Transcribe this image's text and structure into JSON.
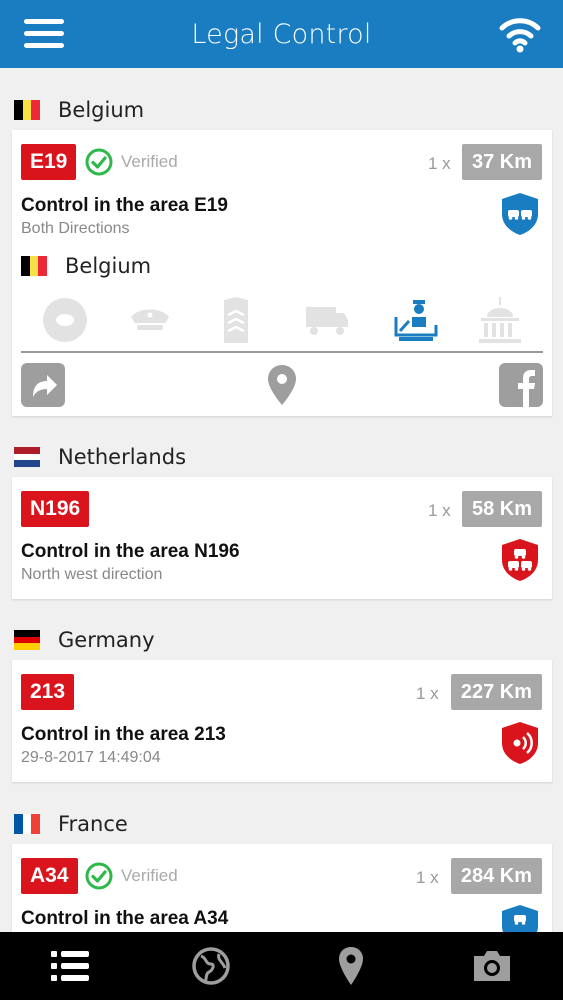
{
  "header": {
    "title": "Legal Control",
    "menu_icon": "hamburger-icon",
    "status_icon": "wifi-icon"
  },
  "colors": {
    "primary": "#1a7cc1",
    "road_red": "#d9141c",
    "verified_green": "#2eb84a",
    "km_grey": "#a8a8a8",
    "icon_blue": "#1a7cc1"
  },
  "controls": [
    {
      "country": "Belgium",
      "road": "E19",
      "verified": true,
      "verified_label": "Verified",
      "count": "1 x",
      "distance": "37 Km",
      "title": "Control in the area E19",
      "subtitle": "Both Directions",
      "shield_color": "blue",
      "shield_icon": "cars-icon",
      "expanded": true,
      "detail_country": "Belgium",
      "categories": [
        "speed-camera-icon",
        "police-cap-icon",
        "military-icon",
        "truck-icon",
        "customs-icon",
        "government-icon"
      ],
      "active_category": "customs-icon",
      "actions": [
        "share-icon",
        "location-pin-icon",
        "facebook-icon"
      ]
    },
    {
      "country": "Netherlands",
      "road": "N196",
      "verified": false,
      "count": "1 x",
      "distance": "58 Km",
      "title": "Control in the area N196",
      "subtitle": "North west direction",
      "shield_color": "red",
      "shield_icon": "cars-icon"
    },
    {
      "country": "Germany",
      "road": "213",
      "verified": false,
      "count": "1 x",
      "distance": "227 Km",
      "title": "Control in the area 213",
      "subtitle": "29-8-2017 14:49:04",
      "shield_color": "red",
      "shield_icon": "radar-icon"
    },
    {
      "country": "France",
      "road": "A34",
      "verified": true,
      "verified_label": "Verified",
      "count": "1 x",
      "distance": "284 Km",
      "title": "Control in the area A34",
      "subtitle": "",
      "shield_color": "blue",
      "shield_icon": "cars-icon"
    }
  ],
  "tabs": [
    "list-icon",
    "globe-icon",
    "map-pin-icon",
    "camera-icon"
  ],
  "active_tab": "list-icon"
}
